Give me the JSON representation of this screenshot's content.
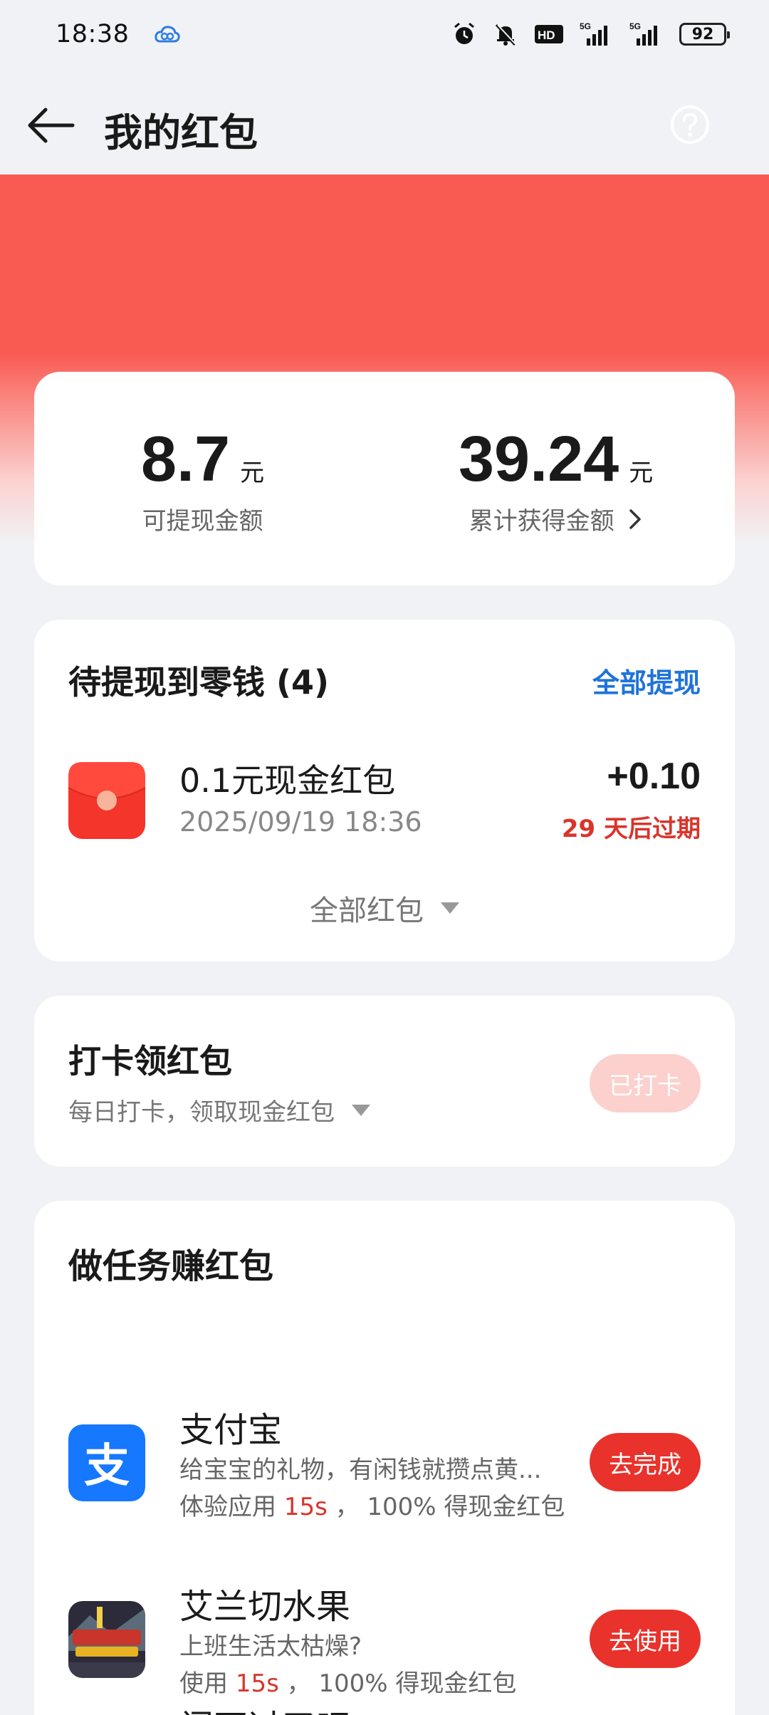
{
  "status_bar": {
    "time": "18:38",
    "battery": "92",
    "icons": [
      "cloud-app-icon",
      "alarm-icon",
      "bell-muted-icon",
      "hd-icon",
      "5g-signal-icon",
      "5g-signal-icon",
      "battery-icon"
    ]
  },
  "header": {
    "title": "我的红包",
    "back_icon": "back-arrow-icon",
    "help_icon": "help-icon"
  },
  "balance": {
    "withdrawable_value": "8.7",
    "withdrawable_unit": "元",
    "withdrawable_label": "可提现金额",
    "total_value": "39.24",
    "total_unit": "元",
    "total_label": "累计获得金额"
  },
  "pending": {
    "title": "待提现到零钱 (4)",
    "withdraw_all": "全部提现",
    "item": {
      "title": "0.1元现金红包",
      "date": "2025/09/19 18:36",
      "amount": "+0.10",
      "expire": "29 天后过期"
    },
    "all_label": "全部红包"
  },
  "checkin": {
    "title": "打卡领红包",
    "subtitle": "每日打卡，领取现金红包",
    "button": "已打卡"
  },
  "tasks": {
    "title": "做任务赚红包",
    "items": [
      {
        "name": "支付宝",
        "desc": "给宝宝的礼物，有闲钱就攒点黄...",
        "reward_prefix": "体验应用",
        "reward_time": "15s",
        "reward_suffix": "， 100% 得现金红包",
        "button": "去完成"
      },
      {
        "name": "艾兰切水果",
        "desc": "上班生活太枯燥?",
        "reward_prefix": "使用",
        "reward_time": "15s",
        "reward_suffix": "， 100% 得现金红包",
        "button": "去使用"
      }
    ],
    "peek_title": "闯不过了吧"
  },
  "colors": {
    "accent_red": "#e8322b",
    "banner_red": "#f95a52",
    "link_blue": "#1f73d9",
    "alipay_blue": "#1677ff"
  }
}
